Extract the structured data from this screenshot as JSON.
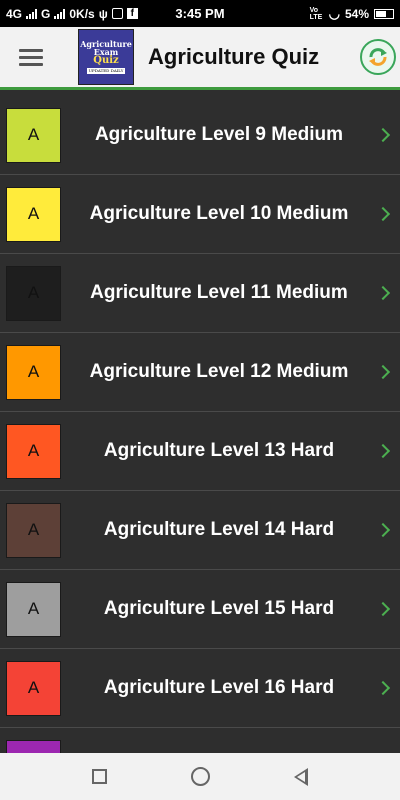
{
  "status_bar": {
    "network1": "4G",
    "network2": "G",
    "speed": "0K/s",
    "time": "3:45 PM",
    "volte": "Vo LTE",
    "battery": "54%"
  },
  "app_bar": {
    "title": "Agriculture Quiz",
    "logo": {
      "line1": "Agriculture",
      "line2": "Exam",
      "line3": "Quiz",
      "line4": "UPDATED DAILY"
    }
  },
  "levels": [
    {
      "badge": "A",
      "label": "Agriculture Level 9 Medium",
      "color": "#c8dd3c"
    },
    {
      "badge": "A",
      "label": "Agriculture Level 10 Medium",
      "color": "#ffeb3b"
    },
    {
      "badge": "A",
      "label": "Agriculture Level 11 Medium",
      "color": "#1e1e1e"
    },
    {
      "badge": "A",
      "label": "Agriculture Level 12 Medium",
      "color": "#ff9800"
    },
    {
      "badge": "A",
      "label": "Agriculture Level 13 Hard",
      "color": "#ff5722"
    },
    {
      "badge": "A",
      "label": "Agriculture Level 14 Hard",
      "color": "#5d4037"
    },
    {
      "badge": "A",
      "label": "Agriculture Level 15 Hard",
      "color": "#9e9e9e"
    },
    {
      "badge": "A",
      "label": "Agriculture Level 16 Hard",
      "color": "#f44336"
    },
    {
      "badge": "",
      "label": "",
      "color": "#9c27b0"
    }
  ],
  "icons": {
    "menu": "hamburger-menu-icon",
    "refresh": "refresh-icon",
    "row_arrow": "chevron-right-icon",
    "nav": [
      "recents-square-icon",
      "home-circle-icon",
      "back-triangle-icon"
    ]
  }
}
